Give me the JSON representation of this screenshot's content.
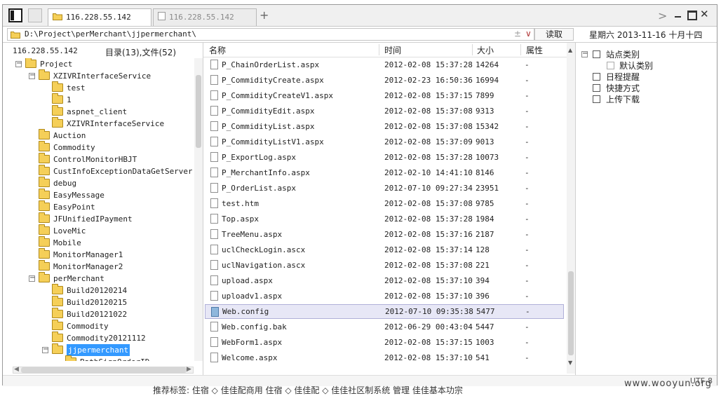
{
  "tabs": [
    {
      "label": "116.228.55.142",
      "active": true
    },
    {
      "label": "116.228.55.142",
      "active": false
    }
  ],
  "tab_add": "+",
  "nav_forward": ">",
  "window_controls": {
    "close": "✕"
  },
  "address": {
    "path": "D:\\Project\\perMerchant\\jjpermerchant\\",
    "plus_minus": "±",
    "dropdown": "∨"
  },
  "read_button": "读取",
  "date_display": "星期六 2013-11-16 十月十四",
  "left_panel": {
    "host": "116.228.55.142",
    "counts": "目录(13),文件(52)"
  },
  "tree": [
    {
      "label": "Project",
      "level": 1,
      "expanded": true
    },
    {
      "label": "XZIVRInterfaceService",
      "level": 2,
      "expanded": true
    },
    {
      "label": "test",
      "level": 3
    },
    {
      "label": "1",
      "level": 3
    },
    {
      "label": "aspnet_client",
      "level": 3
    },
    {
      "label": "XZIVRInterfaceService",
      "level": 3
    },
    {
      "label": "Auction",
      "level": 2
    },
    {
      "label": "Commodity",
      "level": 2
    },
    {
      "label": "ControlMonitorHBJT",
      "level": 2
    },
    {
      "label": "CustInfoExceptionDataGetServers",
      "level": 2
    },
    {
      "label": "debug",
      "level": 2
    },
    {
      "label": "EasyMessage",
      "level": 2
    },
    {
      "label": "EasyPoint",
      "level": 2
    },
    {
      "label": "JFUnifiedIPayment",
      "level": 2
    },
    {
      "label": "LoveMic",
      "level": 2
    },
    {
      "label": "Mobile",
      "level": 2
    },
    {
      "label": "MonitorManager1",
      "level": 2
    },
    {
      "label": "MonitorManager2",
      "level": 2
    },
    {
      "label": "perMerchant",
      "level": 2,
      "expanded": true
    },
    {
      "label": "Build20120214",
      "level": 3
    },
    {
      "label": "Build20120215",
      "level": 3
    },
    {
      "label": "Build20121022",
      "level": 3
    },
    {
      "label": "Commodity",
      "level": 3
    },
    {
      "label": "Commodity20121112",
      "level": 3
    },
    {
      "label": "jjpermerchant",
      "level": 3,
      "expanded": true,
      "selected": true
    },
    {
      "label": "BathSignOrderID",
      "level": 4
    }
  ],
  "file_columns": {
    "name": "名称",
    "time": "时间",
    "size": "大小",
    "attr": "属性"
  },
  "files": [
    {
      "name": "P_ChainOrderList.aspx",
      "time": "2012-02-08 15:37:28",
      "size": "14264",
      "attr": "-"
    },
    {
      "name": "P_CommidityCreate.aspx",
      "time": "2012-02-23 16:50:36",
      "size": "16994",
      "attr": "-"
    },
    {
      "name": "P_CommidityCreateV1.aspx",
      "time": "2012-02-08 15:37:15",
      "size": "7899",
      "attr": "-"
    },
    {
      "name": "P_CommidityEdit.aspx",
      "time": "2012-02-08 15:37:08",
      "size": "9313",
      "attr": "-"
    },
    {
      "name": "P_CommidityList.aspx",
      "time": "2012-02-08 15:37:08",
      "size": "15342",
      "attr": "-"
    },
    {
      "name": "P_CommidityListV1.aspx",
      "time": "2012-02-08 15:37:09",
      "size": "9013",
      "attr": "-"
    },
    {
      "name": "P_ExportLog.aspx",
      "time": "2012-02-08 15:37:28",
      "size": "10073",
      "attr": "-"
    },
    {
      "name": "P_MerchantInfo.aspx",
      "time": "2012-02-10 14:41:10",
      "size": "8146",
      "attr": "-"
    },
    {
      "name": "P_OrderList.aspx",
      "time": "2012-07-10 09:27:34",
      "size": "23951",
      "attr": "-"
    },
    {
      "name": "test.htm",
      "time": "2012-02-08 15:37:08",
      "size": "9785",
      "attr": "-"
    },
    {
      "name": "Top.aspx",
      "time": "2012-02-08 15:37:28",
      "size": "1984",
      "attr": "-"
    },
    {
      "name": "TreeMenu.aspx",
      "time": "2012-02-08 15:37:16",
      "size": "2187",
      "attr": "-"
    },
    {
      "name": "uclCheckLogin.ascx",
      "time": "2012-02-08 15:37:14",
      "size": "128",
      "attr": "-"
    },
    {
      "name": "uclNavigation.ascx",
      "time": "2012-02-08 15:37:08",
      "size": "221",
      "attr": "-"
    },
    {
      "name": "upload.aspx",
      "time": "2012-02-08 15:37:10",
      "size": "394",
      "attr": "-"
    },
    {
      "name": "uploadv1.aspx",
      "time": "2012-02-08 15:37:10",
      "size": "396",
      "attr": "-"
    },
    {
      "name": "Web.config",
      "time": "2012-07-10 09:35:38",
      "size": "5477",
      "attr": "-",
      "selected": true
    },
    {
      "name": "Web.config.bak",
      "time": "2012-06-29 00:43:04",
      "size": "5447",
      "attr": "-"
    },
    {
      "name": "WebForm1.aspx",
      "time": "2012-02-08 15:37:15",
      "size": "1003",
      "attr": "-"
    },
    {
      "name": "Welcome.aspx",
      "time": "2012-02-08 15:37:10",
      "size": "541",
      "attr": "-"
    }
  ],
  "right_panel": [
    {
      "label": "站点类别",
      "icon": "category-icon",
      "expandable": true
    },
    {
      "label": "默认类别",
      "icon": "default-category-icon",
      "child": true
    },
    {
      "label": "日程提醒",
      "icon": "schedule-icon"
    },
    {
      "label": "快捷方式",
      "icon": "shortcut-icon"
    },
    {
      "label": "上传下载",
      "icon": "transfer-icon"
    }
  ],
  "status": {
    "encoding": "UTF-8"
  },
  "watermark": "www.wooyun.org",
  "below_text": "推荐标签: 住宿 ◇ 佳佳配商用 住宿 ◇ 佳佳配 ◇ 佳佳社区制系统 管理 佳佳基本功宗"
}
